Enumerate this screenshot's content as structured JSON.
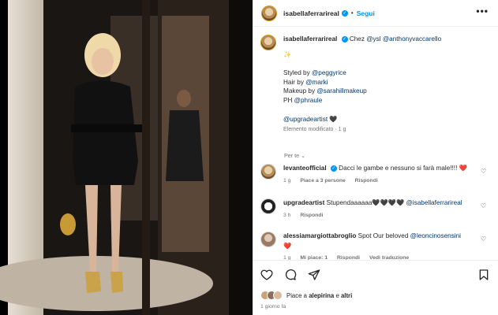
{
  "post": {
    "author": "isabellaferrarireal",
    "follow_label": "Segui",
    "more_label": "•••",
    "verified_mark": "✓"
  },
  "caption": {
    "author": "isabellaferrarireal",
    "line1_prefix": "Chez",
    "line1_mention1": "@ysl",
    "line1_mention2": "@anthonyvaccarello",
    "sparkle": "✨",
    "styled_prefix": "Styled by",
    "styled_mention": "@peggyrice",
    "hair_prefix": "Hair by",
    "hair_mention": "@marki",
    "makeup_prefix": "Makeup by",
    "makeup_mention": "@sarahillmakeup",
    "ph_prefix": "PH",
    "ph_mention": "@phraule",
    "upgrade_mention": "@upgradeartist",
    "black_heart": "🖤",
    "edited_meta": "Elemento modificato · 1 g"
  },
  "translate_label": "Per te ⌄",
  "comments": [
    {
      "user": "levanteofficial",
      "text": "Dacci le gambe e nessuno si farà male!!!! ❤️",
      "time": "1 g",
      "likes": "Piace a 3 persone",
      "reply": "Rispondi"
    },
    {
      "user": "upgradeartist",
      "text": "Stupendaaaaaa🖤🖤🖤🖤",
      "mention": "@isabellaferrarireal",
      "time": "3 h",
      "reply": "Rispondi"
    },
    {
      "user": "alessiamargiottabroglio",
      "text": "Spot Our beloved",
      "mention": "@leoncinosensini",
      "heart": "❤️",
      "time": "1 g",
      "likes": "Mi piace: 1",
      "reply": "Rispondi",
      "translate": "Vedi traduzione"
    }
  ],
  "footer": {
    "likes_prefix": "Piace a",
    "likes_user": "alepirina",
    "likes_and": "e",
    "likes_others": "altri",
    "time_ago": "1 giorno fa"
  },
  "icons": [
    "heart-icon",
    "comment-icon",
    "share-icon",
    "bookmark-icon",
    "more-icon"
  ],
  "colors": {
    "link": "#00376b",
    "follow": "#0095f6",
    "muted": "#737373",
    "verified": "#0095f6"
  }
}
